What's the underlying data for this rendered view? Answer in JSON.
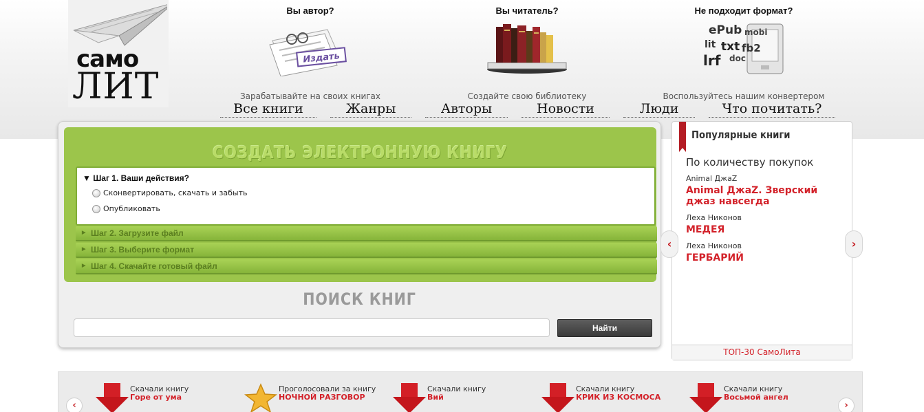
{
  "logo": {
    "line1": "самo",
    "line2": "ЛИТ"
  },
  "promos": [
    {
      "title": "Вы автор?",
      "caption": "Зарабатывайте на своих книгах",
      "badge": "Издать"
    },
    {
      "title": "Вы читатель?",
      "caption": "Создайте свою библиотеку"
    },
    {
      "title": "Не подходит формат?",
      "caption": "Воспользуйтесь нашим конвертером",
      "formats": [
        "ePub",
        "mobi",
        "lit",
        "txt",
        "fb2",
        "lrf",
        "doc"
      ]
    }
  ],
  "nav": [
    "Все книги",
    "Жанры",
    "Авторы",
    "Новости",
    "Люди",
    "Что почитать?"
  ],
  "create": {
    "title": "СОЗДАТЬ ЭЛЕКТРОННУЮ КНИГУ",
    "step1": {
      "title": "Шаг 1. Ваши действия?",
      "options": [
        "Сконвертировать, скачать и забыть",
        "Опубликовать"
      ]
    },
    "steps": [
      "Шаг 2. Загрузите файл",
      "Шаг 3. Выберите формат",
      "Шаг 4. Скачайте готовый файл"
    ]
  },
  "search": {
    "title": "ПОИСК КНИГ",
    "value": "",
    "button": "Найти"
  },
  "popular": {
    "title": "Популярные книги",
    "subtitle": "По количеству покупок",
    "books": [
      {
        "author": "Animal ДжаZ",
        "title": "Animal ДжаZ. Зверский джаз навсегда"
      },
      {
        "author": "Леха Никонов",
        "title": "МЕДЕЯ"
      },
      {
        "author": "Леха Никонов",
        "title": "ГЕРБАРИЙ"
      }
    ],
    "footer": "ТОП-30 СамоЛита",
    "prev": "‹",
    "next": "›"
  },
  "feed": {
    "prev": "‹",
    "next": "›",
    "items": [
      {
        "type": "download",
        "label": "Скачали книгу",
        "book": "Горе от ума"
      },
      {
        "type": "vote",
        "label": "Проголосовали за книгу",
        "book": "НОЧНОЙ РАЗГОВОР"
      },
      {
        "type": "download",
        "label": "Скачали книгу",
        "book": "Вий"
      },
      {
        "type": "download",
        "label": "Скачали книгу",
        "book": "КРИК ИЗ КОСМОСА"
      },
      {
        "type": "download",
        "label": "Скачали книгу",
        "book": "Восьмой ангел"
      }
    ]
  },
  "colors": {
    "green": "#9cc54b",
    "accent_red": "#d3222a",
    "dark_button": "#3a3a3a"
  }
}
